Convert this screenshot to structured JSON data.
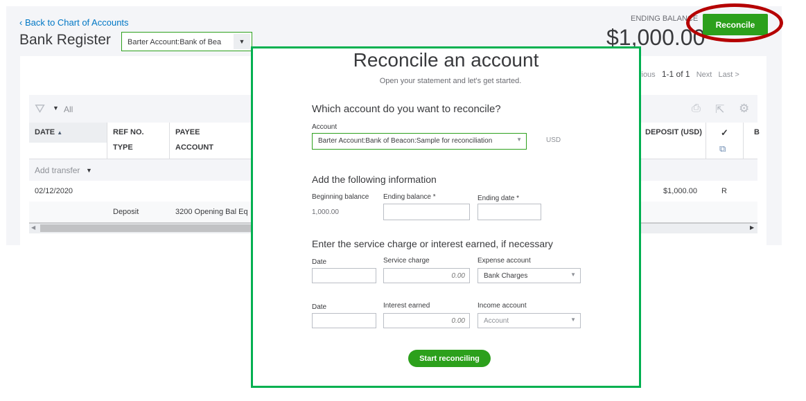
{
  "header": {
    "back_link": "Back to Chart of Accounts",
    "title": "Bank Register",
    "account_select": "Barter Account:Bank of Bea",
    "ending_balance_label": "ENDING BALANCE",
    "ending_balance": "$1,000.00",
    "reconcile_button": "Reconcile"
  },
  "pager": {
    "previous": "vious",
    "range": "1-1 of 1",
    "next": "Next",
    "last": "Last >"
  },
  "toolbar": {
    "filter": "All"
  },
  "table": {
    "headers": {
      "date": "DATE",
      "ref": "REF NO.",
      "type": "TYPE",
      "payee": "PAYEE",
      "account": "ACCOUNT",
      "deposit": "DEPOSIT (USD)",
      "check": "✓",
      "extra": "B"
    },
    "add_transfer": "Add transfer",
    "rows": [
      {
        "date": "02/12/2020",
        "type": "Deposit",
        "account": "3200 Opening Bal Eq",
        "deposit": "$1,000.00",
        "status": "R"
      }
    ]
  },
  "modal": {
    "title": "Reconcile an account",
    "subtitle": "Open your statement and let's get started.",
    "q1": "Which account do you want to reconcile?",
    "account_label": "Account",
    "account_value": "Barter Account:Bank of Beacon:Sample for reconciliation",
    "currency": "USD",
    "section2": "Add the following information",
    "beginning_label": "Beginning balance",
    "beginning_value": "1,000.00",
    "ending_balance_label": "Ending balance *",
    "ending_date_label": "Ending date *",
    "section3": "Enter the service charge or interest earned, if necessary",
    "date_label": "Date",
    "service_charge_label": "Service charge",
    "service_charge_placeholder": "0.00",
    "expense_label": "Expense account",
    "expense_value": "Bank Charges",
    "date2_label": "Date",
    "interest_label": "Interest earned",
    "interest_placeholder": "0.00",
    "income_label": "Income account",
    "income_placeholder": "Account",
    "start_button": "Start reconciling"
  }
}
